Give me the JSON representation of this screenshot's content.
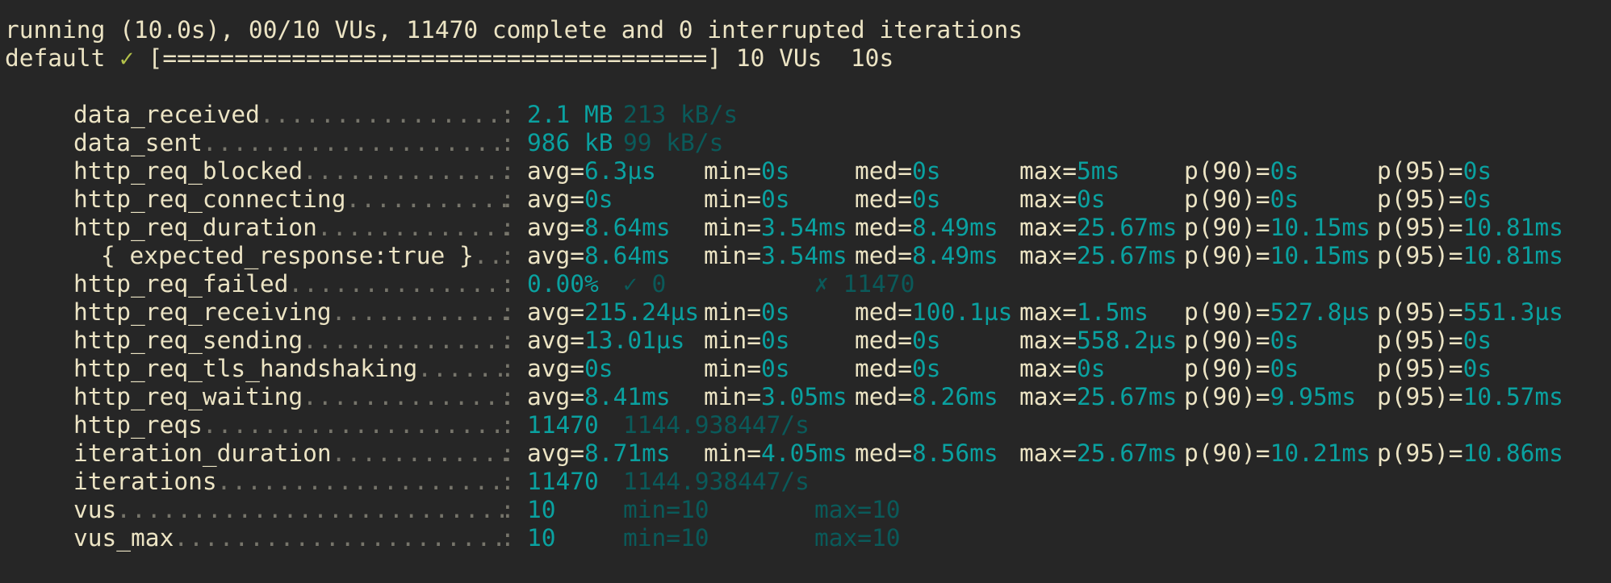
{
  "header": {
    "status_line": "running (10.0s), 00/10 VUs, 11470 complete and 0 interrupted iterations",
    "scenario_name": "default",
    "checkmark": "✓",
    "progress_bar": "[======================================]",
    "vus": "10 VUs",
    "duration": "10s"
  },
  "colors": {
    "background": "#262626",
    "text": "#ece4c4",
    "value": "#0aa1a0",
    "dim_value": "#0a5a5a",
    "check": "#b3c14a",
    "dots": "#77756b"
  },
  "metrics": [
    {
      "name": "data_received",
      "main": "2.1 MB",
      "rate": "213 kB/s"
    },
    {
      "name": "data_sent",
      "main": "986 kB",
      "rate": "99 kB/s"
    },
    {
      "name": "http_req_blocked",
      "stats": [
        {
          "k": "avg=",
          "v": "6.3µs"
        },
        {
          "k": "min=",
          "v": "0s"
        },
        {
          "k": "med=",
          "v": "0s"
        },
        {
          "k": "max=",
          "v": "5ms"
        },
        {
          "k": "p(90)=",
          "v": "0s"
        },
        {
          "k": "p(95)=",
          "v": "0s"
        }
      ]
    },
    {
      "name": "http_req_connecting",
      "stats": [
        {
          "k": "avg=",
          "v": "0s"
        },
        {
          "k": "min=",
          "v": "0s"
        },
        {
          "k": "med=",
          "v": "0s"
        },
        {
          "k": "max=",
          "v": "0s"
        },
        {
          "k": "p(90)=",
          "v": "0s"
        },
        {
          "k": "p(95)=",
          "v": "0s"
        }
      ]
    },
    {
      "name": "http_req_duration",
      "stats": [
        {
          "k": "avg=",
          "v": "8.64ms"
        },
        {
          "k": "min=",
          "v": "3.54ms"
        },
        {
          "k": "med=",
          "v": "8.49ms"
        },
        {
          "k": "max=",
          "v": "25.67ms"
        },
        {
          "k": "p(90)=",
          "v": "10.15ms"
        },
        {
          "k": "p(95)=",
          "v": "10.81ms"
        }
      ]
    },
    {
      "name": "{ expected_response:true }",
      "indent": true,
      "stats": [
        {
          "k": "avg=",
          "v": "8.64ms"
        },
        {
          "k": "min=",
          "v": "3.54ms"
        },
        {
          "k": "med=",
          "v": "8.49ms"
        },
        {
          "k": "max=",
          "v": "25.67ms"
        },
        {
          "k": "p(90)=",
          "v": "10.15ms"
        },
        {
          "k": "p(95)=",
          "v": "10.81ms"
        }
      ]
    },
    {
      "name": "http_req_failed",
      "main": "0.00%",
      "pass": "✓ 0",
      "fail": "✗ 11470"
    },
    {
      "name": "http_req_receiving",
      "stats": [
        {
          "k": "avg=",
          "v": "215.24µs"
        },
        {
          "k": "min=",
          "v": "0s"
        },
        {
          "k": "med=",
          "v": "100.1µs"
        },
        {
          "k": "max=",
          "v": "1.5ms"
        },
        {
          "k": "p(90)=",
          "v": "527.8µs"
        },
        {
          "k": "p(95)=",
          "v": "551.3µs"
        }
      ]
    },
    {
      "name": "http_req_sending",
      "stats": [
        {
          "k": "avg=",
          "v": "13.01µs"
        },
        {
          "k": "min=",
          "v": "0s"
        },
        {
          "k": "med=",
          "v": "0s"
        },
        {
          "k": "max=",
          "v": "558.2µs"
        },
        {
          "k": "p(90)=",
          "v": "0s"
        },
        {
          "k": "p(95)=",
          "v": "0s"
        }
      ]
    },
    {
      "name": "http_req_tls_handshaking",
      "stats": [
        {
          "k": "avg=",
          "v": "0s"
        },
        {
          "k": "min=",
          "v": "0s"
        },
        {
          "k": "med=",
          "v": "0s"
        },
        {
          "k": "max=",
          "v": "0s"
        },
        {
          "k": "p(90)=",
          "v": "0s"
        },
        {
          "k": "p(95)=",
          "v": "0s"
        }
      ]
    },
    {
      "name": "http_req_waiting",
      "stats": [
        {
          "k": "avg=",
          "v": "8.41ms"
        },
        {
          "k": "min=",
          "v": "3.05ms"
        },
        {
          "k": "med=",
          "v": "8.26ms"
        },
        {
          "k": "max=",
          "v": "25.67ms"
        },
        {
          "k": "p(90)=",
          "v": "9.95ms"
        },
        {
          "k": "p(95)=",
          "v": "10.57ms"
        }
      ]
    },
    {
      "name": "http_reqs",
      "main": "11470",
      "rate": "1144.938447/s"
    },
    {
      "name": "iteration_duration",
      "stats": [
        {
          "k": "avg=",
          "v": "8.71ms"
        },
        {
          "k": "min=",
          "v": "4.05ms"
        },
        {
          "k": "med=",
          "v": "8.56ms"
        },
        {
          "k": "max=",
          "v": "25.67ms"
        },
        {
          "k": "p(90)=",
          "v": "10.21ms"
        },
        {
          "k": "p(95)=",
          "v": "10.86ms"
        }
      ]
    },
    {
      "name": "iterations",
      "main": "11470",
      "rate": "1144.938447/s"
    },
    {
      "name": "vus",
      "main": "10",
      "min": "min=10",
      "max": "max=10"
    },
    {
      "name": "vus_max",
      "main": "10",
      "min": "min=10",
      "max": "max=10"
    }
  ]
}
